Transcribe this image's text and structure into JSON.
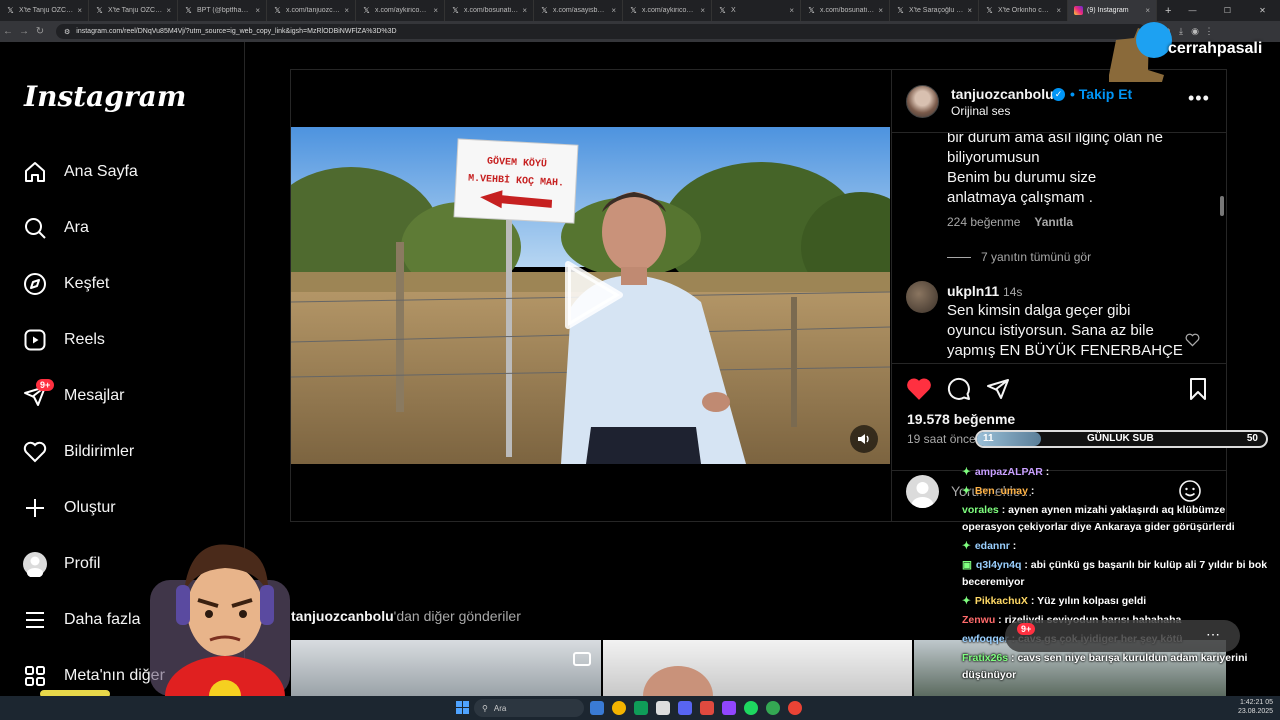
{
  "browser": {
    "tabs": [
      {
        "label": "X'te Tanju ÖZCAN:",
        "icon": "x-icon"
      },
      {
        "label": "X'te Tanju ÖZCAN:",
        "icon": "x-icon"
      },
      {
        "label": "BPT (@bptfhaber) /",
        "icon": "x-icon"
      },
      {
        "label": "x.com/tanjuozcan",
        "icon": "x-icon"
      },
      {
        "label": "x.com/aykiricomtr",
        "icon": "x-icon"
      },
      {
        "label": "x.com/bosunatiklar",
        "icon": "x-icon"
      },
      {
        "label": "x.com/asayisberkem",
        "icon": "x-icon"
      },
      {
        "label": "x.com/aykiricomtr",
        "icon": "x-icon"
      },
      {
        "label": "X",
        "icon": "x-icon"
      },
      {
        "label": "x.com/bosunatiklar",
        "icon": "x-icon"
      },
      {
        "label": "X'te Saraçoğlu Spor",
        "icon": "x-icon"
      },
      {
        "label": "X'te Orkinho cu: \"İl...",
        "icon": "x-icon"
      },
      {
        "label": "(9) Instagram",
        "icon": "instagram-icon",
        "active": true
      }
    ],
    "new_tab": "+",
    "url": "instagram.com/reel/DNqVu85M4Vj/?utm_source=ig_web_copy_link&igsh=MzRlODBiNWFlZA%3D%3D"
  },
  "instagram": {
    "logo": "Instagram",
    "nav": [
      {
        "label": "Ana Sayfa",
        "icon": "home-icon"
      },
      {
        "label": "Ara",
        "icon": "search-icon"
      },
      {
        "label": "Keşfet",
        "icon": "compass-icon"
      },
      {
        "label": "Reels",
        "icon": "reels-icon"
      },
      {
        "label": "Mesajlar",
        "icon": "messages-icon",
        "badge": "9+"
      },
      {
        "label": "Bildirimler",
        "icon": "heart-icon"
      },
      {
        "label": "Oluştur",
        "icon": "plus-icon"
      },
      {
        "label": "Profil",
        "icon": "profile-icon"
      },
      {
        "label": "Daha fazla",
        "icon": "menu-icon"
      },
      {
        "label": "Meta'nın diğer",
        "icon": "meta-apps-icon"
      }
    ],
    "post": {
      "username": "tanjuozcanbolu",
      "follow": "Takip Et",
      "separator": "•",
      "audio": "Orijinal ses",
      "video_sign": {
        "line1": "GÖVEM KÖYÜ",
        "line2": "M.VEHBİ KOÇ MAH."
      },
      "comments": [
        {
          "text": "bir durum ama asıl ilginç olan ne biliyorumusun Benim bu durumu size anlatmaya çalışmam .",
          "lines": [
            "bir durum ama asıl ilginç olan ne",
            "biliyorumusun",
            "Benim bu durumu size",
            "anlatmaya çalışmam ."
          ],
          "likes": "224 beğenme",
          "reply": "Yanıtla"
        },
        {
          "view_replies": "7 yanıtın tümünü gör"
        },
        {
          "user": "ukpln11",
          "time": "14s",
          "lines": [
            "Sen kimsin dalga geçer gibi",
            "oyuncu istiyorsun. Sana az bile",
            "yapmış EN BÜYÜK FENERBAHÇE"
          ]
        }
      ],
      "likes": "19.578 beğenme",
      "time_ago": "19 saat önce",
      "add_comment": "Yorum ekle..."
    },
    "more_posts": {
      "user": "tanjuozcanbolu",
      "suffix": "'dan diğer gönderiler"
    }
  },
  "overlay": {
    "brand": "cerrahpasali",
    "sub_goal": {
      "current": "11",
      "label": "GÜNLUK SUB",
      "target": "50",
      "fraction": 0.22
    },
    "chat": [
      {
        "user": "ampazALPAR",
        "text": "",
        "color": "#c9a0ff",
        "badge": "✦"
      },
      {
        "user": "Ben_umay",
        "text": "",
        "color": "#ffb347",
        "badge": "✦"
      },
      {
        "user": "vorales",
        "text": "aynen aynen mizahi yaklaşırdı aq klübümze operasyon çekiyorlar diye Ankaraya gider görüşürlerdi",
        "color": "#7fff7f",
        "badge": ""
      },
      {
        "user": "edannr",
        "text": "",
        "color": "#9ad0ff",
        "badge": "✦"
      },
      {
        "user": "q3l4yn4q",
        "text": "abi çünkü gs başarılı bir kulüp ali 7 yıldır bi bok beceremiyor",
        "color": "#9ad0ff",
        "badge": "▣"
      },
      {
        "user": "PikkachuX",
        "text": "Yüz yılın kolpası geldi",
        "color": "#ffd966",
        "badge": "✦"
      },
      {
        "user": "Zenwu",
        "text": "rizeliydi seviyodun barısı hahahaha",
        "color": "#ff6b6b",
        "badge": ""
      },
      {
        "user": "ewfoqqer",
        "text": "cavs gs çok iyidiger her şey kötü",
        "color": "#9ad0ff",
        "badge": ""
      },
      {
        "user": "Fratix26s",
        "text": "cavs sen niye barışa kuruldun adam kariyerini düşünüyor",
        "color": "#7fff7f",
        "badge": ""
      }
    ],
    "bottom_widget_badge": "9+"
  },
  "taskbar": {
    "search": "Ara",
    "time": "1:42:21 05",
    "date": "23.08.2025"
  },
  "colors": {
    "accent": "#0095f6",
    "like": "#ff3040",
    "bg": "#000000"
  }
}
